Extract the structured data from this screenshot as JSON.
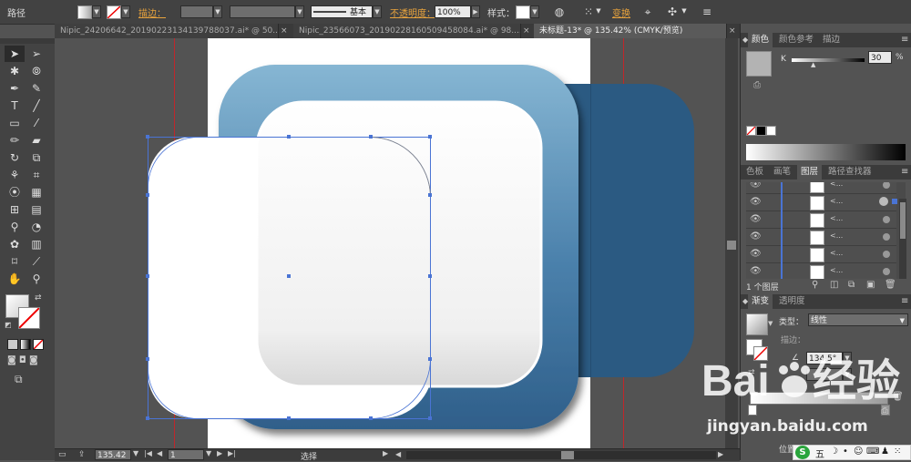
{
  "control_bar": {
    "path_label": "路径",
    "stroke_label": "描边：",
    "stroke_style": "基本",
    "opacity_label": "不透明度：",
    "opacity_value": "100%",
    "style_label": "样式：",
    "transform_label": "变换"
  },
  "tabs": [
    {
      "label": "Nipic_24206642_20190223134139788037.ai* @ 50...",
      "active": false
    },
    {
      "label": "Nipic_23566073_20190228160509458084.ai* @ 98....",
      "active": false
    },
    {
      "label": "未标题-13* @ 135.42% (CMYK/预览)",
      "active": true
    }
  ],
  "tab_close": "×",
  "color_panel": {
    "tabs": [
      "颜色",
      "颜色参考",
      "描边"
    ],
    "channel": "K",
    "value": "30",
    "unit": "%"
  },
  "layers_panel": {
    "tabs": [
      "色板",
      "画笔",
      "图层",
      "路径查找器"
    ],
    "row_label": "<...",
    "footer": "1 个图层"
  },
  "gradient_panel": {
    "tabs": [
      "渐变",
      "透明度"
    ],
    "type_label": "类型：",
    "type_value": "线性",
    "stroke_label": "描边：",
    "angle_value": "134.5°",
    "position_label": "位置"
  },
  "status": {
    "zoom": "135.42",
    "page": "1",
    "mode": "选择"
  },
  "watermark": {
    "url": "jingyan.baidu.com"
  },
  "colors": {
    "blue_dark": "#2b5a82",
    "blue_light": "#7fb0cf",
    "selection": "#4a74d4",
    "guide": "#c0262b",
    "orange": "#e8a33d"
  }
}
